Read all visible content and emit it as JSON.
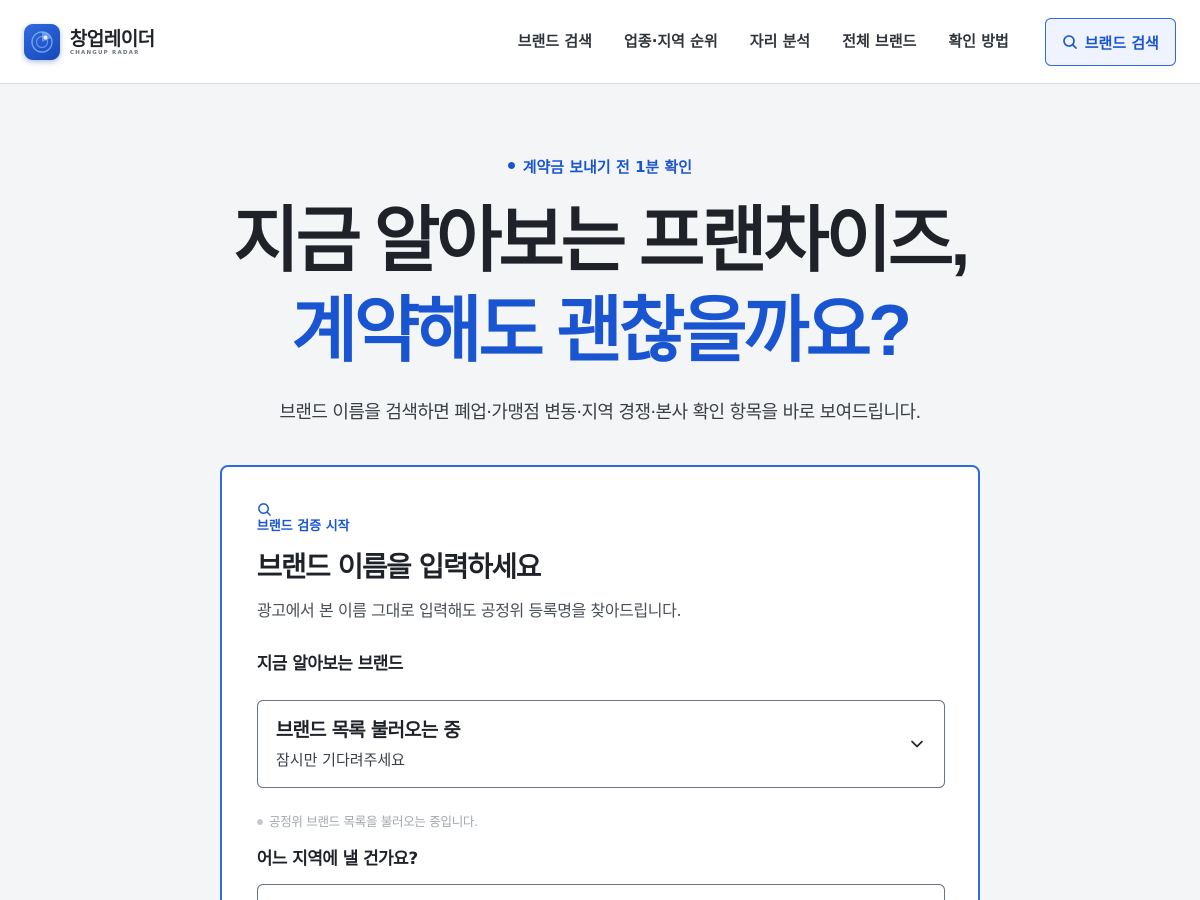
{
  "brand": {
    "name": "창업레이더",
    "sub": "CHANGUP RADAR",
    "accent": "#1a55d1"
  },
  "nav": {
    "items": [
      "브랜드 검색",
      "업종·지역 순위",
      "자리 분석",
      "전체 브랜드",
      "확인 방법"
    ],
    "search_button": "브랜드 검색"
  },
  "hero": {
    "eyebrow": "계약금 보내기 전 1분 확인",
    "title_line1": "지금 알아보는 프랜차이즈,",
    "title_line2": "계약해도 괜찮을까요?",
    "subtitle": "브랜드 이름을 검색하면 폐업·가맹점 변동·지역 경쟁·본사 확인 항목을 바로 보여드립니다."
  },
  "card": {
    "eyebrow": "브랜드 검증 시작",
    "title": "브랜드 이름을 입력하세요",
    "desc": "광고에서 본 이름 그대로 입력해도 공정위 등록명을 찾아드립니다.",
    "brand_field": {
      "label": "지금 알아보는 브랜드",
      "main": "브랜드 목록 불러오는 중",
      "sub": "잠시만 기다려주세요"
    },
    "hint": "공정위 브랜드 목록을 불러오는 중입니다.",
    "region_field": {
      "label": "어느 지역에 낼 건가요?"
    }
  }
}
